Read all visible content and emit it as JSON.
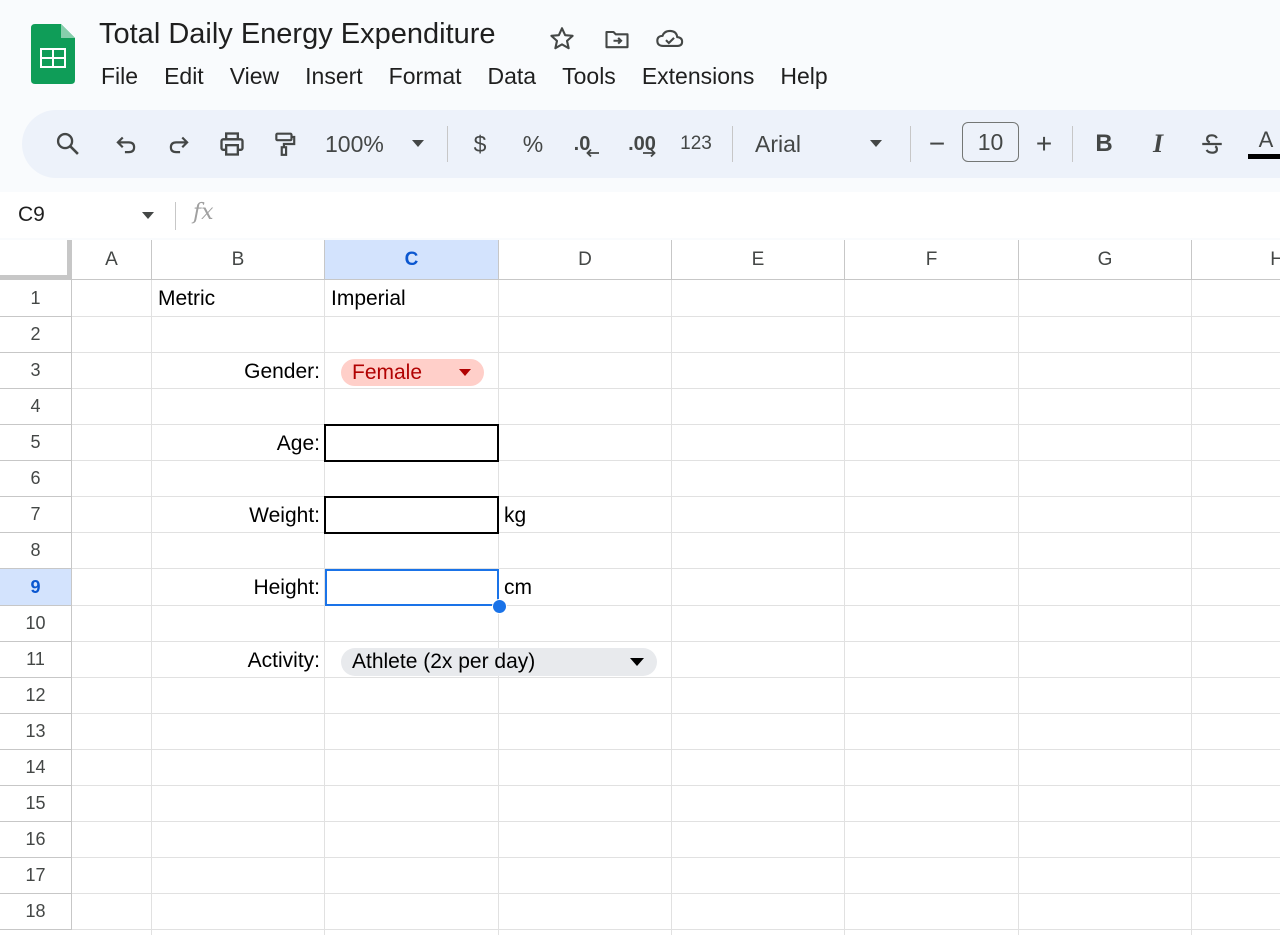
{
  "app": {
    "doc_title": "Total Daily Energy Expenditure",
    "header_icons": [
      "star-icon",
      "move-to-folder-icon",
      "cloud-status-icon"
    ]
  },
  "menu": [
    "File",
    "Edit",
    "View",
    "Insert",
    "Format",
    "Data",
    "Tools",
    "Extensions",
    "Help"
  ],
  "toolbar": {
    "zoom": "100%",
    "currency": "$",
    "percent": "%",
    "decrease_decimal": ".0",
    "increase_decimal": ".00",
    "number_format": "123",
    "font": "Arial",
    "font_size": "10",
    "minus": "−",
    "plus": "+",
    "bold": "B",
    "italic": "I",
    "text_color": "A"
  },
  "formula_bar": {
    "name_box": "C9",
    "fx": "fx",
    "formula": ""
  },
  "grid": {
    "columns": [
      "A",
      "B",
      "C",
      "D",
      "E",
      "F",
      "G",
      "H"
    ],
    "selected_column": "C",
    "rows": [
      "1",
      "2",
      "3",
      "4",
      "5",
      "6",
      "7",
      "8",
      "9",
      "10",
      "11",
      "12",
      "13",
      "14",
      "15",
      "16",
      "17",
      "18"
    ],
    "selected_row": "9",
    "cells": {
      "B1": "Metric",
      "C1": "Imperial",
      "B3": "Gender:",
      "B5": "Age:",
      "B7": "Weight:",
      "D7": "kg",
      "B9": "Height:",
      "D9": "cm",
      "B11": "Activity:"
    },
    "dropdowns": {
      "gender": {
        "value": "Female",
        "bg": "#ffcfc9",
        "fg": "#b10202"
      },
      "activity": {
        "value": "Athlete (2x per day)",
        "bg": "#e8eaed",
        "fg": "#000000"
      }
    },
    "inputs": {
      "C5": "",
      "C7": "",
      "C9": ""
    }
  },
  "colors": {
    "accent": "#1a73e8",
    "header_selected_bg": "#d3e3fd",
    "toolbar_bg": "#edf2fa",
    "sheets_green": "#0f9d58"
  }
}
